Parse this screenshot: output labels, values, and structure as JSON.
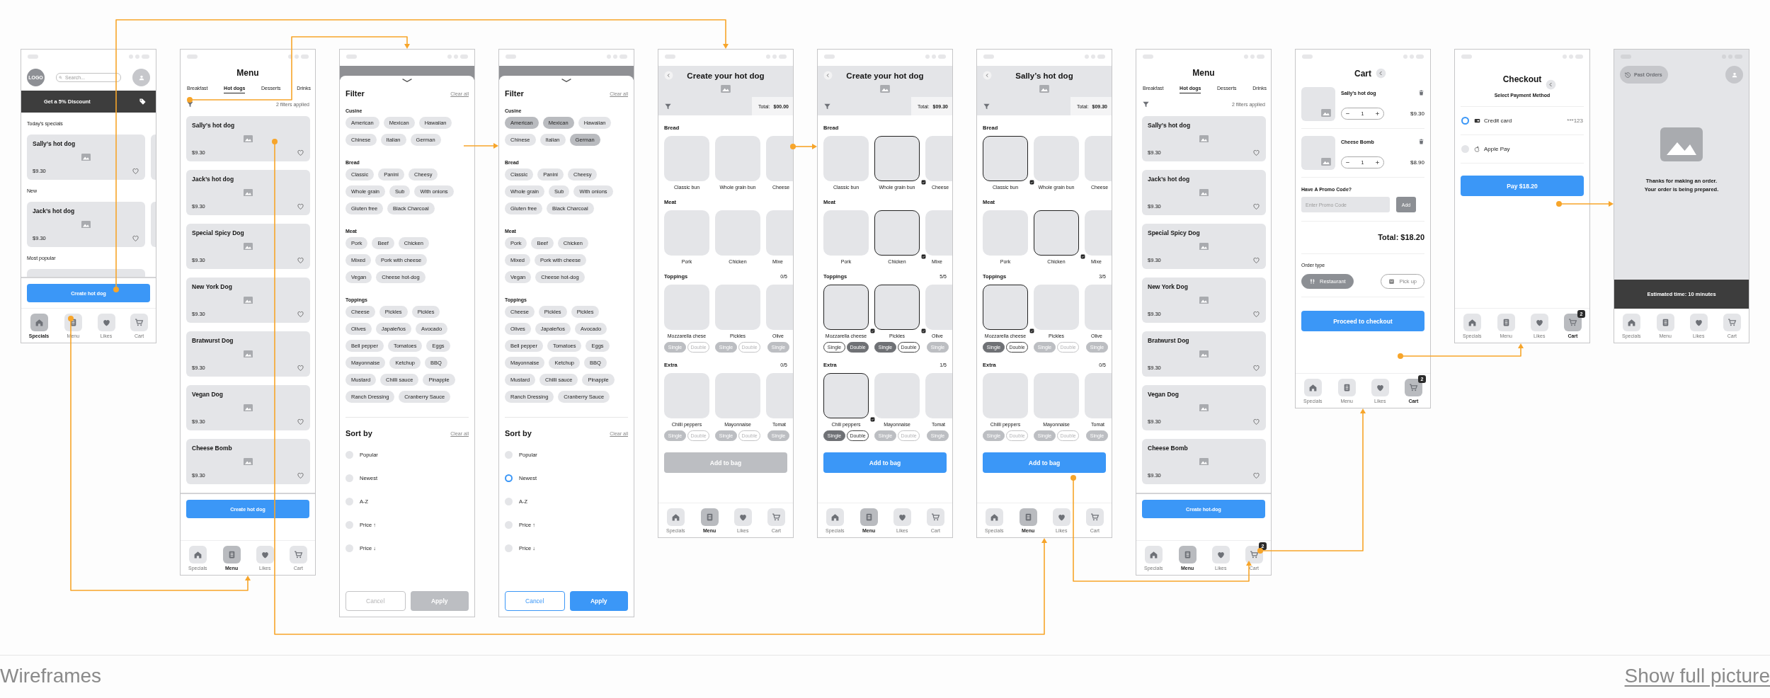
{
  "screens": [
    {
      "kind": "home",
      "logo": "LOGO",
      "search_placeholder": "Search...",
      "banner": "Get a 5% Discount",
      "sections": [
        {
          "title": "Today’s specials",
          "cards": [
            {
              "name": "Sally’s hot dog",
              "price": "$9.30"
            }
          ]
        },
        {
          "title": "New",
          "cards": [
            {
              "name": "Jack’s hot dog",
              "price": "$9.30"
            }
          ]
        },
        {
          "title": "Most popular"
        }
      ],
      "button": "Create hot dog",
      "nav": [
        {
          "label": "Specials",
          "selected": true
        },
        {
          "label": "Menu",
          "selected": false
        },
        {
          "label": "Likes",
          "selected": false
        },
        {
          "label": "Cart",
          "selected": false
        }
      ]
    },
    {
      "kind": "menu",
      "title": "Menu",
      "tabs": [
        {
          "label": "Breakfast",
          "selected": false
        },
        {
          "label": "Hot dogs",
          "selected": true
        },
        {
          "label": "Desserts",
          "selected": false
        },
        {
          "label": "Drinks",
          "selected": false
        }
      ],
      "filters_note": "2 filters applied",
      "items": [
        {
          "name": "Sally’s hot dog",
          "price": "$9.30"
        },
        {
          "name": "Jack’s hot dog",
          "price": "$9.30"
        },
        {
          "name": "Special Spicy Dog",
          "price": "$9.30"
        },
        {
          "name": "New York Dog",
          "price": "$9.30"
        },
        {
          "name": "Bratwurst Dog",
          "price": "$9.30"
        },
        {
          "name": "Vegan Dog",
          "price": "$9.30"
        },
        {
          "name": "Cheese Bomb",
          "price": "$9.30"
        }
      ],
      "button": "Create hot dog",
      "nav": [
        {
          "label": "Specials",
          "selected": false
        },
        {
          "label": "Menu",
          "selected": true
        },
        {
          "label": "Likes",
          "selected": false
        },
        {
          "label": "Cart",
          "selected": false
        }
      ]
    },
    {
      "kind": "filter",
      "title": "Filter",
      "clear": "Clear all",
      "groups": [
        {
          "title": "Cusine",
          "rows": [
            [
              {
                "label": "American",
                "selected": false
              },
              {
                "label": "Mexican",
                "selected": false
              },
              {
                "label": "Hawaiian",
                "selected": false
              }
            ],
            [
              {
                "label": "Chinese",
                "selected": false
              },
              {
                "label": "Italian",
                "selected": false
              },
              {
                "label": "German",
                "selected": false
              }
            ]
          ]
        },
        {
          "title": "Bread",
          "rows": [
            [
              {
                "label": "Classic",
                "selected": false
              },
              {
                "label": "Panini",
                "selected": false
              },
              {
                "label": "Cheesy",
                "selected": false
              }
            ],
            [
              {
                "label": "Whole grain",
                "selected": false
              },
              {
                "label": "Sub",
                "selected": false
              },
              {
                "label": "With onions",
                "selected": false
              }
            ],
            [
              {
                "label": "Gluten free",
                "selected": false
              },
              {
                "label": "Black Charcoal",
                "selected": false
              }
            ]
          ]
        },
        {
          "title": "Meat",
          "rows": [
            [
              {
                "label": "Pork",
                "selected": false
              },
              {
                "label": "Beef",
                "selected": false
              },
              {
                "label": "Chicken",
                "selected": false
              }
            ],
            [
              {
                "label": "Mixed",
                "selected": false
              },
              {
                "label": "Pork with cheese",
                "selected": false
              }
            ],
            [
              {
                "label": "Vegan",
                "selected": false
              },
              {
                "label": "Cheese hot-dog",
                "selected": false
              }
            ]
          ]
        },
        {
          "title": "Toppings",
          "rows": [
            [
              {
                "label": "Cheese",
                "selected": false
              },
              {
                "label": "Pickles",
                "selected": false
              },
              {
                "label": "Pickles",
                "selected": false
              }
            ],
            [
              {
                "label": "Olives",
                "selected": false
              },
              {
                "label": "Japaleños",
                "selected": false
              },
              {
                "label": "Avocado",
                "selected": false
              }
            ],
            [
              {
                "label": "Bell pepper",
                "selected": false
              },
              {
                "label": "Tomatoes",
                "selected": false
              },
              {
                "label": "Eggs",
                "selected": false
              }
            ],
            [
              {
                "label": "Mayonnaise",
                "selected": false
              },
              {
                "label": "Ketchup",
                "selected": false
              },
              {
                "label": "BBQ",
                "selected": false
              }
            ],
            [
              {
                "label": "Mustard",
                "selected": false
              },
              {
                "label": "Chilli sauce",
                "selected": false
              },
              {
                "label": "Pinapple",
                "selected": false
              }
            ],
            [
              {
                "label": "Ranch Dressing",
                "selected": false
              },
              {
                "label": "Cranberry Sauce",
                "selected": false
              }
            ]
          ]
        }
      ],
      "sort_title": "Sort by",
      "sort_clear": "Clear all",
      "sort_options": [
        {
          "label": "Popular",
          "selected": false
        },
        {
          "label": "Newest",
          "selected": false
        },
        {
          "label": "A-Z",
          "selected": false
        },
        {
          "label": "Price ↑",
          "selected": false
        },
        {
          "label": "Price ↓",
          "selected": false
        }
      ],
      "buttons": [
        {
          "label": "Cancel",
          "kind": "secondary",
          "disabled": true
        },
        {
          "label": "Apply",
          "kind": "primary",
          "disabled": true
        }
      ]
    },
    {
      "kind": "filter",
      "title": "Filter",
      "clear": "Clear all",
      "groups": [
        {
          "title": "Cusine",
          "rows": [
            [
              {
                "label": "American",
                "selected": true
              },
              {
                "label": "Mexican",
                "selected": true
              },
              {
                "label": "Hawaiian",
                "selected": false
              }
            ],
            [
              {
                "label": "Chinese",
                "selected": false
              },
              {
                "label": "Italian",
                "selected": false
              },
              {
                "label": "German",
                "selected": true
              }
            ]
          ]
        },
        {
          "title": "Bread",
          "rows": [
            [
              {
                "label": "Classic",
                "selected": false
              },
              {
                "label": "Panini",
                "selected": false
              },
              {
                "label": "Cheesy",
                "selected": false
              }
            ],
            [
              {
                "label": "Whole grain",
                "selected": false
              },
              {
                "label": "Sub",
                "selected": false
              },
              {
                "label": "With onions",
                "selected": false
              }
            ],
            [
              {
                "label": "Gluten free",
                "selected": false
              },
              {
                "label": "Black Charcoal",
                "selected": false
              }
            ]
          ]
        },
        {
          "title": "Meat",
          "rows": [
            [
              {
                "label": "Pork",
                "selected": false
              },
              {
                "label": "Beef",
                "selected": false
              },
              {
                "label": "Chicken",
                "selected": false
              }
            ],
            [
              {
                "label": "Mixed",
                "selected": false
              },
              {
                "label": "Pork with cheese",
                "selected": false
              }
            ],
            [
              {
                "label": "Vegan",
                "selected": false
              },
              {
                "label": "Cheese hot-dog",
                "selected": false
              }
            ]
          ]
        },
        {
          "title": "Toppings",
          "rows": [
            [
              {
                "label": "Cheese",
                "selected": false
              },
              {
                "label": "Pickles",
                "selected": false
              },
              {
                "label": "Pickles",
                "selected": false
              }
            ],
            [
              {
                "label": "Olives",
                "selected": false
              },
              {
                "label": "Japaleños",
                "selected": false
              },
              {
                "label": "Avocado",
                "selected": false
              }
            ],
            [
              {
                "label": "Bell pepper",
                "selected": false
              },
              {
                "label": "Tomatoes",
                "selected": false
              },
              {
                "label": "Eggs",
                "selected": false
              }
            ],
            [
              {
                "label": "Mayonnaise",
                "selected": false
              },
              {
                "label": "Ketchup",
                "selected": false
              },
              {
                "label": "BBQ",
                "selected": false
              }
            ],
            [
              {
                "label": "Mustard",
                "selected": false
              },
              {
                "label": "Chilli sauce",
                "selected": false
              },
              {
                "label": "Pinapple",
                "selected": false
              }
            ],
            [
              {
                "label": "Ranch Dressing",
                "selected": false
              },
              {
                "label": "Cranberry Sauce",
                "selected": false
              }
            ]
          ]
        }
      ],
      "sort_title": "Sort by",
      "sort_clear": "Clear all",
      "sort_options": [
        {
          "label": "Popular",
          "selected": false
        },
        {
          "label": "Newest",
          "selected": true
        },
        {
          "label": "A-Z",
          "selected": false
        },
        {
          "label": "Price ↑",
          "selected": false
        },
        {
          "label": "Price ↓",
          "selected": false
        }
      ],
      "buttons": [
        {
          "label": "Cancel",
          "kind": "secondary",
          "disabled": false
        },
        {
          "label": "Apply",
          "kind": "primary",
          "disabled": false
        }
      ]
    },
    {
      "kind": "builder",
      "title": "Create your hot dog",
      "total": "Total: **$00.00**",
      "sections": [
        {
          "title": "Bread",
          "items": [
            {
              "label": "Classic bun",
              "checked": false
            },
            {
              "label": "Whole grain bun",
              "checked": false
            },
            {
              "label": "Cheese",
              "checked": false,
              "cut": true
            }
          ]
        },
        {
          "title": "Meat",
          "items": [
            {
              "label": "Pork",
              "checked": false
            },
            {
              "label": "Chicken",
              "checked": false
            },
            {
              "label": "Mixe",
              "checked": false,
              "cut": true
            }
          ]
        },
        {
          "title": "Toppings",
          "count": "0/5",
          "items": [
            {
              "label": "Mozzarella chese",
              "checked": false,
              "portions": [
                {
                  "label": "Single",
                  "selected": true
                },
                {
                  "label": "Double",
                  "selected": false
                }
              ]
            },
            {
              "label": "Pickles",
              "checked": false,
              "portions": [
                {
                  "label": "Single",
                  "selected": true
                },
                {
                  "label": "Double",
                  "selected": false
                }
              ]
            },
            {
              "label": "Olive",
              "checked": false,
              "cut": true,
              "portions": [
                {
                  "label": "Single",
                  "selected": true
                }
              ]
            }
          ]
        },
        {
          "title": "Extra",
          "count": "0/5",
          "items": [
            {
              "label": "Chilli peppers",
              "checked": false,
              "portions": [
                {
                  "label": "Single",
                  "selected": true
                },
                {
                  "label": "Double",
                  "selected": false
                }
              ]
            },
            {
              "label": "Mayonnaise",
              "checked": false,
              "portions": [
                {
                  "label": "Single",
                  "selected": true
                },
                {
                  "label": "Double",
                  "selected": false
                }
              ]
            },
            {
              "label": "Tomat",
              "checked": false,
              "cut": true,
              "portions": [
                {
                  "label": "Single",
                  "selected": true
                }
              ]
            }
          ]
        }
      ],
      "add_button": {
        "label": "Add to bag",
        "disabled": true
      },
      "nav": [
        {
          "label": "Specials",
          "selected": false
        },
        {
          "label": "Menu",
          "selected": true
        },
        {
          "label": "Likes",
          "selected": false
        },
        {
          "label": "Cart",
          "selected": false
        }
      ]
    },
    {
      "kind": "builder",
      "title": "Create your hot dog",
      "total": "Total: **$09.30**",
      "sections": [
        {
          "title": "Bread",
          "items": [
            {
              "label": "Classic bun",
              "checked": false
            },
            {
              "label": "Whole grain bun",
              "checked": true
            },
            {
              "label": "Cheese",
              "checked": false,
              "cut": true
            }
          ]
        },
        {
          "title": "Meat",
          "items": [
            {
              "label": "Pork",
              "checked": false
            },
            {
              "label": "Chicken",
              "checked": true
            },
            {
              "label": "Mixe",
              "checked": false,
              "cut": true
            }
          ]
        },
        {
          "title": "Toppings",
          "count": "5/5",
          "items": [
            {
              "label": "Mozzarella cheese",
              "checked": true,
              "portions": [
                {
                  "label": "Single",
                  "selected": false
                },
                {
                  "label": "Double",
                  "selected": true
                }
              ]
            },
            {
              "label": "Pickles",
              "checked": true,
              "portions": [
                {
                  "label": "Single",
                  "selected": true
                },
                {
                  "label": "Double",
                  "selected": false
                }
              ]
            },
            {
              "label": "Olive",
              "checked": false,
              "cut": true,
              "portions": [
                {
                  "label": "Single",
                  "selected": true
                }
              ]
            }
          ]
        },
        {
          "title": "Extra",
          "count": "1/5",
          "items": [
            {
              "label": "Chili peppers",
              "checked": true,
              "portions": [
                {
                  "label": "Single",
                  "selected": true
                },
                {
                  "label": "Double",
                  "selected": false
                }
              ]
            },
            {
              "label": "Mayonnaise",
              "checked": false,
              "portions": [
                {
                  "label": "Single",
                  "selected": true
                },
                {
                  "label": "Double",
                  "selected": false
                }
              ]
            },
            {
              "label": "Tomat",
              "checked": false,
              "cut": true,
              "portions": [
                {
                  "label": "Single",
                  "selected": true
                }
              ]
            }
          ]
        }
      ],
      "add_button": {
        "label": "Add to bag",
        "disabled": false
      },
      "nav": [
        {
          "label": "Specials",
          "selected": false
        },
        {
          "label": "Menu",
          "selected": true
        },
        {
          "label": "Likes",
          "selected": false
        },
        {
          "label": "Cart",
          "selected": false
        }
      ]
    },
    {
      "kind": "builder",
      "title": "Sally’s hot dog",
      "total": "Total: **$09.30**",
      "sections": [
        {
          "title": "Bread",
          "items": [
            {
              "label": "Classic bun",
              "checked": true
            },
            {
              "label": "Whole grain bun",
              "checked": false
            },
            {
              "label": "Cheese",
              "checked": false,
              "cut": true
            }
          ]
        },
        {
          "title": "Meat",
          "items": [
            {
              "label": "Pork",
              "checked": false
            },
            {
              "label": "Chicken",
              "checked": true
            },
            {
              "label": "Mixe",
              "checked": false,
              "cut": true
            }
          ]
        },
        {
          "title": "Toppings",
          "count": "3/5",
          "items": [
            {
              "label": "Mozzarella cheese",
              "checked": true,
              "portions": [
                {
                  "label": "Single",
                  "selected": true
                },
                {
                  "label": "Double",
                  "selected": false
                }
              ]
            },
            {
              "label": "Pickles",
              "checked": false,
              "portions": [
                {
                  "label": "Single",
                  "selected": true
                },
                {
                  "label": "Double",
                  "selected": false
                }
              ]
            },
            {
              "label": "Olive",
              "checked": false,
              "cut": true,
              "portions": [
                {
                  "label": "Single",
                  "selected": true
                }
              ]
            }
          ]
        },
        {
          "title": "Extra",
          "count": "0/5",
          "items": [
            {
              "label": "Chilli peppers",
              "checked": false,
              "portions": [
                {
                  "label": "Single",
                  "selected": true
                },
                {
                  "label": "Double",
                  "selected": false
                }
              ]
            },
            {
              "label": "Mayonnaise",
              "checked": false,
              "portions": [
                {
                  "label": "Single",
                  "selected": true
                },
                {
                  "label": "Double",
                  "selected": false
                }
              ]
            },
            {
              "label": "Tomat",
              "checked": false,
              "cut": true,
              "portions": [
                {
                  "label": "Single",
                  "selected": true
                }
              ]
            }
          ]
        }
      ],
      "add_button": {
        "label": "Add to bag",
        "disabled": false
      },
      "nav": [
        {
          "label": "Specials",
          "selected": false
        },
        {
          "label": "Menu",
          "selected": true
        },
        {
          "label": "Likes",
          "selected": false
        },
        {
          "label": "Cart",
          "selected": false
        }
      ]
    },
    {
      "kind": "menu",
      "title": "Menu",
      "tabs": [
        {
          "label": "Breakfast",
          "selected": false
        },
        {
          "label": "Hot dogs",
          "selected": true
        },
        {
          "label": "Desserts",
          "selected": false
        },
        {
          "label": "Drinks",
          "selected": false
        }
      ],
      "filters_note": "2 filters applied",
      "items": [
        {
          "name": "Sally’s hot dog",
          "price": "$9.30"
        },
        {
          "name": "Jack’s hot dog",
          "price": "$9.30"
        },
        {
          "name": "Special Spicy Dog",
          "price": "$9.30"
        },
        {
          "name": "New York Dog",
          "price": "$9.30"
        },
        {
          "name": "Bratwurst Dog",
          "price": "$9.30"
        },
        {
          "name": "Vegan Dog",
          "price": "$9.30"
        },
        {
          "name": "Cheese Bomb",
          "price": "$9.30"
        }
      ],
      "button": "Create hot-dog",
      "cart_badge": "2",
      "nav": [
        {
          "label": "Specials",
          "selected": false
        },
        {
          "label": "Menu",
          "selected": true
        },
        {
          "label": "Likes",
          "selected": false
        },
        {
          "label": "Cart",
          "selected": false
        }
      ]
    },
    {
      "kind": "cart",
      "title": "Cart",
      "items": [
        {
          "name": "Sally’s hot dog",
          "qty": "1",
          "price": "$9.30"
        },
        {
          "name": "Cheese Bomb",
          "qty": "1",
          "price": "$8.90"
        }
      ],
      "promo_title": "Have A Promo Code?",
      "promo_placeholder": "Enter Promo Code",
      "promo_button": "Add",
      "total": "Total: $18.20",
      "order_type_title": "Order type",
      "order_types": [
        {
          "label": "Restaurant",
          "selected": true
        },
        {
          "label": "Pick up",
          "selected": false
        }
      ],
      "button": "Proceed to checkout",
      "cart_badge": "2",
      "nav": [
        {
          "label": "Specials",
          "selected": false
        },
        {
          "label": "Menu",
          "selected": false
        },
        {
          "label": "Likes",
          "selected": false
        },
        {
          "label": "Cart",
          "selected": true
        }
      ]
    },
    {
      "kind": "checkout",
      "title": "Checkout",
      "subtitle": "Select Payment Method",
      "methods": [
        {
          "label": "Credit card",
          "detail": "***123",
          "selected": true
        },
        {
          "label": "Apple Pay",
          "selected": false
        }
      ],
      "button": "Pay $18.20",
      "cart_badge": "2",
      "nav": [
        {
          "label": "Specials",
          "selected": false
        },
        {
          "label": "Menu",
          "selected": false
        },
        {
          "label": "Likes",
          "selected": false
        },
        {
          "label": "Cart",
          "selected": true
        }
      ]
    },
    {
      "kind": "confirmation",
      "past_orders": "Past Orders",
      "message": [
        "Thanks for making an order.",
        "Your order is being prepared."
      ],
      "eta": "Estimated time: 10 minutes",
      "nav": [
        {
          "label": "Specials",
          "selected": false
        },
        {
          "label": "Menu",
          "selected": false
        },
        {
          "label": "Likes",
          "selected": false
        },
        {
          "label": "Cart",
          "selected": false
        }
      ]
    }
  ],
  "footer": {
    "title": "Wireframes",
    "link": "Show full picture"
  }
}
